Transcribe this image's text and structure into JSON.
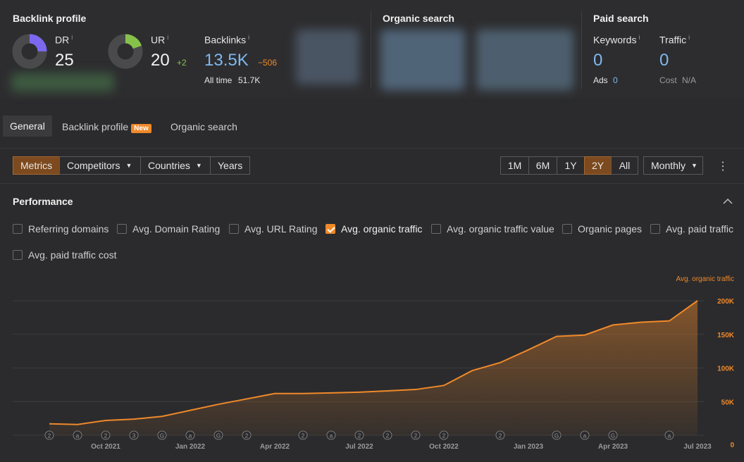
{
  "header": {
    "backlink_profile": {
      "title": "Backlink profile",
      "dr_label": "DR",
      "dr_value": "25",
      "ur_label": "UR",
      "ur_value": "20",
      "ur_change": "+2",
      "backlinks_label": "Backlinks",
      "backlinks_value": "13.5K",
      "backlinks_change": "−506",
      "alltime_label": "All time",
      "alltime_value": "51.7K",
      "info": "i"
    },
    "organic_search": {
      "title": "Organic search"
    },
    "paid_search": {
      "title": "Paid search",
      "keywords_label": "Keywords",
      "keywords_value": "0",
      "traffic_label": "Traffic",
      "traffic_value": "0",
      "ads_label": "Ads",
      "ads_value": "0",
      "cost_label": "Cost",
      "cost_value": "N/A"
    }
  },
  "tabs": [
    {
      "label": "General"
    },
    {
      "label": "Backlink profile",
      "badge": "New"
    },
    {
      "label": "Organic search"
    }
  ],
  "toolbar": {
    "views": [
      "Metrics",
      "Competitors",
      "Countries",
      "Years"
    ],
    "ranges": [
      "1M",
      "6M",
      "1Y",
      "2Y",
      "All"
    ],
    "granularity": "Monthly",
    "more_icon": "more-vertical-icon"
  },
  "performance": {
    "title": "Performance",
    "checkboxes": [
      {
        "label": "Referring domains",
        "checked": false
      },
      {
        "label": "Avg. Domain Rating",
        "checked": false
      },
      {
        "label": "Avg. URL Rating",
        "checked": false
      },
      {
        "label": "Avg. organic traffic",
        "checked": true
      },
      {
        "label": "Avg. organic traffic value",
        "checked": false
      },
      {
        "label": "Organic pages",
        "checked": false
      },
      {
        "label": "Avg. paid traffic",
        "checked": false
      },
      {
        "label": "Avg. paid traffic cost",
        "checked": false
      }
    ]
  },
  "colors": {
    "accent": "#f0892a",
    "blue": "#7fb8f0",
    "green": "#86c24a",
    "dr_ring": "#7b68ee",
    "ur_ring": "#86c24a"
  },
  "chart_data": {
    "type": "area",
    "series": [
      {
        "name": "Avg. organic traffic",
        "x": [
          "2021-08",
          "2021-09",
          "2021-10",
          "2021-11",
          "2021-12",
          "2022-01",
          "2022-02",
          "2022-03",
          "2022-04",
          "2022-05",
          "2022-06",
          "2022-07",
          "2022-08",
          "2022-09",
          "2022-10",
          "2022-11",
          "2022-12",
          "2023-01",
          "2023-02",
          "2023-03",
          "2023-04",
          "2023-05",
          "2023-06",
          "2023-07"
        ],
        "values": [
          17000,
          16000,
          22000,
          24000,
          28000,
          37000,
          46000,
          54000,
          62000,
          62000,
          63000,
          64000,
          66000,
          68000,
          74000,
          96000,
          108000,
          127000,
          147000,
          149000,
          164000,
          168000,
          170000,
          200000
        ]
      }
    ],
    "x_ticks": [
      "Oct 2021",
      "Jan 2022",
      "Apr 2022",
      "Jul 2022",
      "Oct 2022",
      "Jan 2023",
      "Apr 2023",
      "Jul 2023"
    ],
    "y_ticks": [
      "0",
      "50K",
      "100K",
      "150K",
      "200K"
    ],
    "ylim": [
      0,
      200000
    ],
    "annotations": [
      "2",
      "a",
      "2",
      "3",
      "G",
      "a",
      "G",
      "2",
      "2",
      "a",
      "2",
      "2",
      "2",
      "2",
      "2",
      "G",
      "a",
      "G",
      "a"
    ],
    "grid": true
  }
}
